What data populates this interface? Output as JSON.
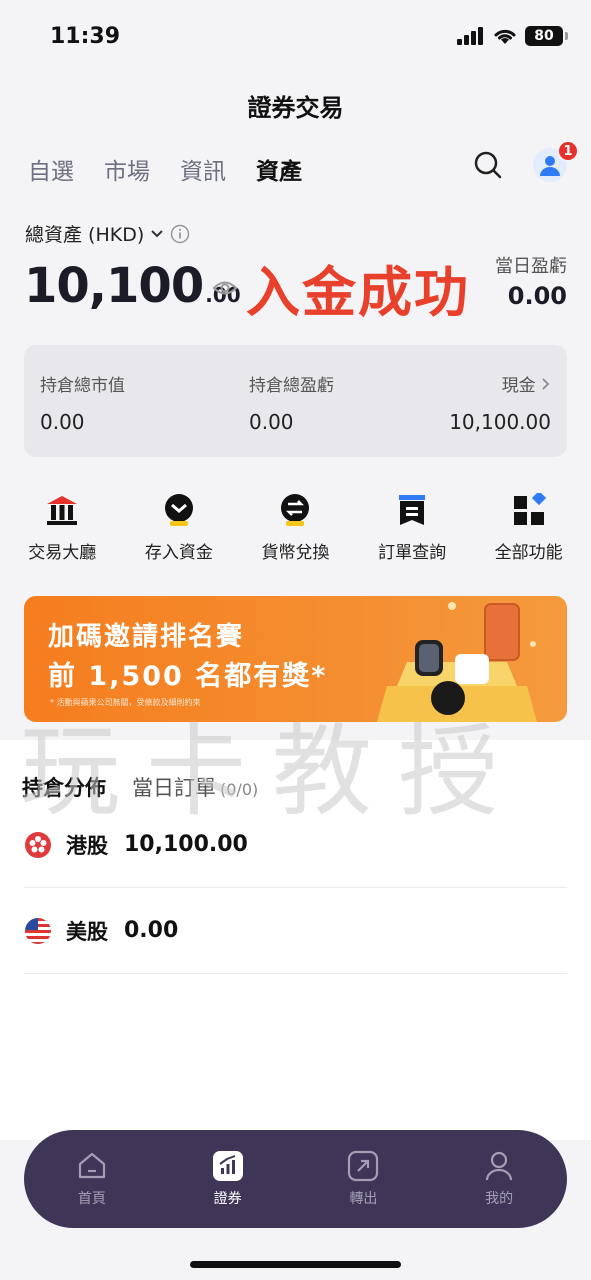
{
  "status_bar": {
    "time": "11:39",
    "battery": "80"
  },
  "page_title": "證券交易",
  "tabs": [
    {
      "label": "自選",
      "active": false
    },
    {
      "label": "市場",
      "active": false
    },
    {
      "label": "資訊",
      "active": false
    },
    {
      "label": "資產",
      "active": true
    }
  ],
  "notification_count": "1",
  "assets": {
    "label": "總資產 (HKD)",
    "amount_main": "10,100",
    "amount_decimal": ".00",
    "overlay_text": "入金成功",
    "daily_pl_label": "當日盈虧",
    "daily_pl_value": "0.00"
  },
  "summary": {
    "market_value_label": "持倉總市值",
    "market_value": "0.00",
    "total_pl_label": "持倉總盈虧",
    "total_pl": "0.00",
    "cash_label": "現金",
    "cash": "10,100.00"
  },
  "quick_actions": [
    {
      "label": "交易大廳",
      "icon": "trading-hall-icon"
    },
    {
      "label": "存入資金",
      "icon": "deposit-icon"
    },
    {
      "label": "貨幣兌換",
      "icon": "currency-exchange-icon"
    },
    {
      "label": "訂單查詢",
      "icon": "order-query-icon"
    },
    {
      "label": "全部功能",
      "icon": "all-functions-icon"
    }
  ],
  "banner": {
    "line1": "加碼邀請排名賽",
    "line2": "前 1,500 名都有獎*",
    "note": "* 活動與蘋果公司無關，受條款及細則約束"
  },
  "watermark": "玩卡教授",
  "holdings": {
    "tab_positions": "持倉分佈",
    "tab_orders": "當日訂單",
    "orders_count": "(0/0)",
    "rows": [
      {
        "name": "港股",
        "value": "10,100.00"
      },
      {
        "name": "美股",
        "value": "0.00"
      }
    ]
  },
  "bottom_nav": [
    {
      "label": "首頁",
      "active": false
    },
    {
      "label": "證券",
      "active": true
    },
    {
      "label": "轉出",
      "active": false
    },
    {
      "label": "我的",
      "active": false
    }
  ],
  "colors": {
    "accent_red": "#e8402b",
    "nav_bg": "#3f3556",
    "banner_orange": "#f57d1e"
  }
}
